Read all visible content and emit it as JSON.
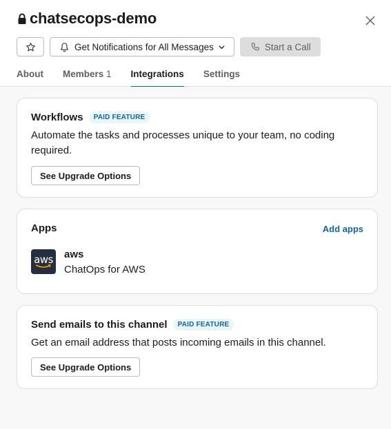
{
  "header": {
    "title": "chatsecops-demo",
    "lock_icon": "lock-icon",
    "close_icon": "close-icon",
    "actions": {
      "star_icon": "star-icon",
      "notifications_label": "Get Notifications for All Messages",
      "bell_icon": "bell-icon",
      "chevron_icon": "chevron-down-icon",
      "call_label": "Start a Call",
      "phone_icon": "phone-icon"
    },
    "tabs": [
      {
        "label": "About",
        "count": ""
      },
      {
        "label": "Members",
        "count": "1"
      },
      {
        "label": "Integrations",
        "count": "",
        "active": true
      },
      {
        "label": "Settings",
        "count": ""
      }
    ]
  },
  "colors": {
    "active_tab_underline": "#007a5a",
    "link": "#1264a3",
    "badge_bg": "#e8f5fa",
    "aws_logo_bg": "#232f3e",
    "aws_smile": "#ff9900"
  },
  "workflows": {
    "title": "Workflows",
    "badge": "PAID FEATURE",
    "description": "Automate the tasks and processes unique to your team, no coding required.",
    "button": "See Upgrade Options"
  },
  "apps": {
    "title": "Apps",
    "add_label": "Add apps",
    "items": [
      {
        "logo_text": "aws",
        "name": "aws",
        "description": "ChatOps for AWS"
      }
    ]
  },
  "email": {
    "title": "Send emails to this channel",
    "badge": "PAID FEATURE",
    "description": "Get an email address that posts incoming emails in this channel.",
    "button": "See Upgrade Options"
  }
}
